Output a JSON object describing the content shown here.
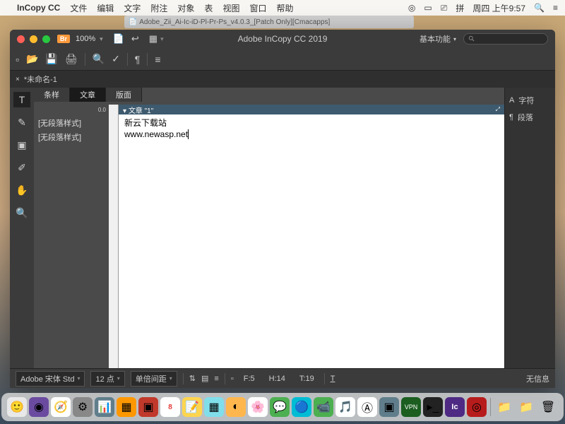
{
  "mac_menu": {
    "app_name": "InCopy CC",
    "items": [
      "文件",
      "编辑",
      "文字",
      "附注",
      "对象",
      "表",
      "视图",
      "窗口",
      "帮助"
    ],
    "right": {
      "ime": "拼",
      "datetime": "周四 上午9:57"
    }
  },
  "finder_tab": "Adobe_Zii_Ai-Ic-iD-Pl-Pr-Ps_v4.0.3_[Patch Only][Cmacapps]",
  "titlebar": {
    "br_badge": "Br",
    "zoom": "100%",
    "app_title": "Adobe InCopy CC 2019",
    "workspace": "基本功能"
  },
  "doc_tab": "*未命名-1",
  "view_tabs": {
    "t0": "条样",
    "t1": "文章",
    "t2": "版面"
  },
  "ruler_zero": "0.0",
  "styles": {
    "s0": "[无段落样式]",
    "s1": "[无段落样式]"
  },
  "story_header": "文章 \"1\"",
  "content": {
    "line1": "新云下载站",
    "line2": "www.newasp.net"
  },
  "right_panel": {
    "char": "字符",
    "para": "段落"
  },
  "status": {
    "font": "Adobe 宋体 Std",
    "size": "12 点",
    "leading": "单倍间距",
    "f": "F:5",
    "h": "H:14",
    "t": "T:19",
    "noinfo": "无信息"
  },
  "dock_colors": [
    "#2196f3",
    "#6b4ba0",
    "#4285f4",
    "#888",
    "#607d8b",
    "#ff9800",
    "#c0392b",
    "#fff",
    "#ffd54f",
    "#80deea",
    "#ffb74d",
    "#9c27b0",
    "#4caf50",
    "#00bcd4",
    "#4caf50",
    "#e91e63",
    "#2196f3",
    "#607d8b",
    "#1b5e20",
    "#424242",
    "#4e2a84",
    "#b71c1c"
  ]
}
